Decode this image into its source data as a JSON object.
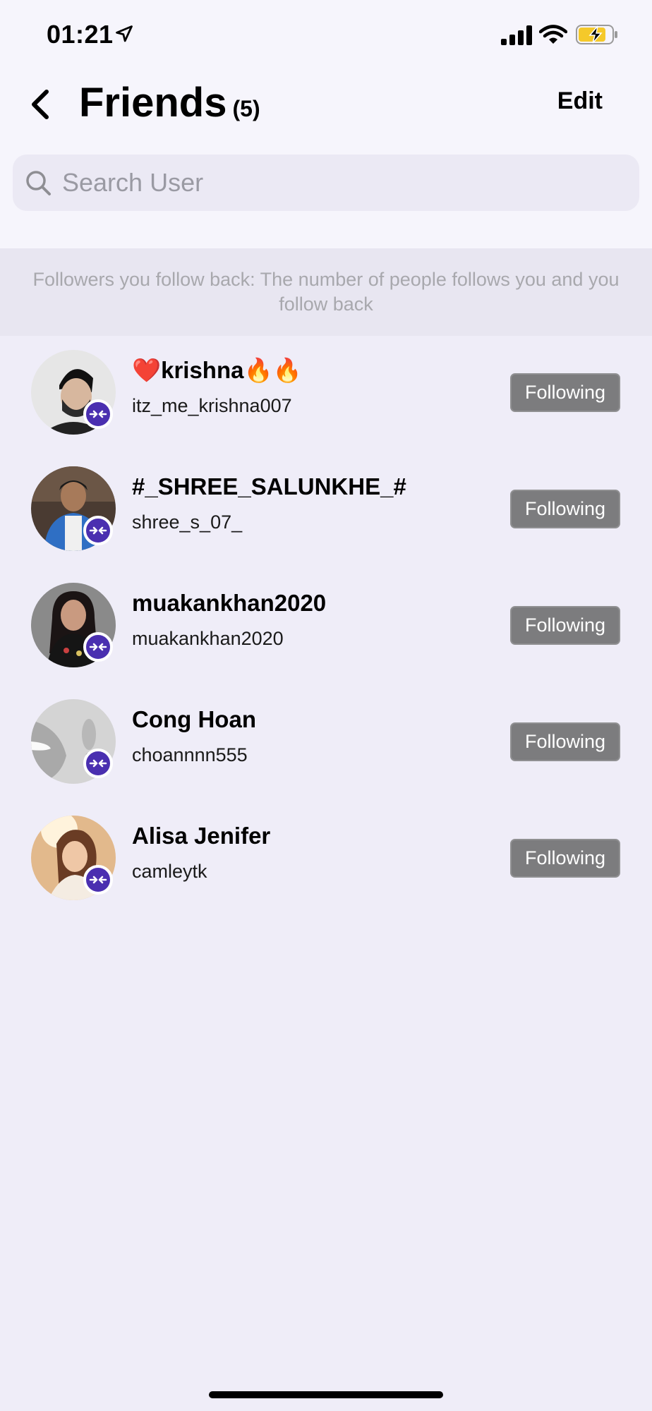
{
  "status_bar": {
    "time": "01:21"
  },
  "header": {
    "title": "Friends",
    "count": "(5)",
    "edit_label": "Edit"
  },
  "search": {
    "placeholder": "Search User"
  },
  "info_banner": {
    "text": "Followers you follow back: The number of people follows you and you follow back"
  },
  "friends": [
    {
      "display_name": "❤️krishna🔥🔥",
      "username": "itz_me_krishna007",
      "button_label": "Following"
    },
    {
      "display_name": "#_SHREE_SALUNKHE_#",
      "username": "shree_s_07_",
      "button_label": "Following"
    },
    {
      "display_name": "muakankhan2020",
      "username": "muakankhan2020",
      "button_label": "Following"
    },
    {
      "display_name": "Cong Hoan",
      "username": "choannnn555",
      "button_label": "Following"
    },
    {
      "display_name": "Alisa Jenifer",
      "username": "camleytk",
      "button_label": "Following"
    }
  ],
  "colors": {
    "background": "#efedf8",
    "badge": "#4a2fb0",
    "following_button": "#7c7c7e",
    "battery_fill": "#f5c92a"
  },
  "icons": [
    "location-arrow-icon",
    "signal-icon",
    "wifi-icon",
    "battery-charging-icon",
    "back-chevron-icon",
    "search-icon",
    "friend-badge-icon"
  ]
}
